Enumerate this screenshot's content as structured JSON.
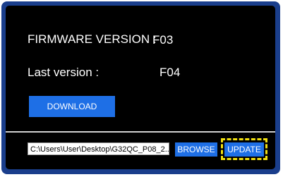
{
  "firmware": {
    "label": "FIRMWARE VERSION :",
    "value": "F03"
  },
  "last_version": {
    "label": "Last version :",
    "value": "F04"
  },
  "download_button": "DOWNLOAD",
  "file_path": "C:\\Users\\User\\Desktop\\G32QC_P08_2...",
  "browse_button": "BROWSE",
  "update_button": "UPDATE",
  "colors": {
    "frame": "#1a3e8c",
    "panel": "#000000",
    "button": "#1e6fe6",
    "highlight": "#f2e010"
  }
}
